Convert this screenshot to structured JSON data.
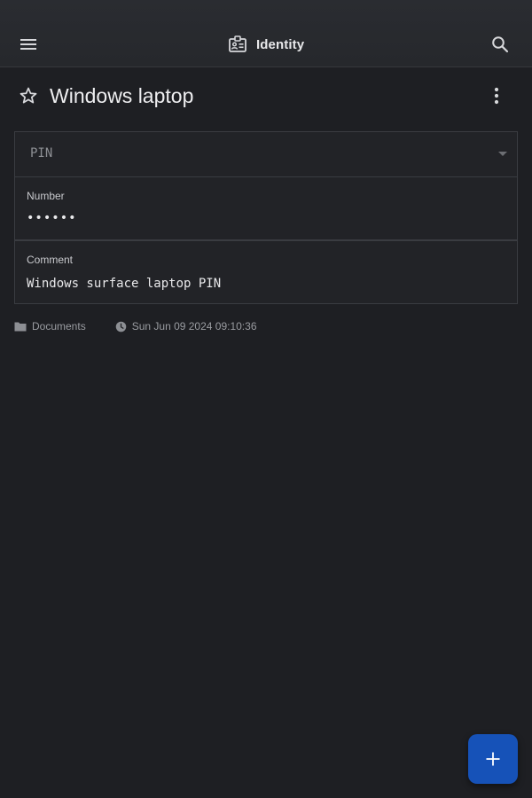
{
  "app_bar": {
    "title": "Identity",
    "menu_icon": "menu-icon",
    "title_icon": "identity-card-icon",
    "search_icon": "search-icon"
  },
  "entry": {
    "title": "Windows laptop",
    "favorite_icon": "star-outline-icon",
    "more_icon": "more-vertical-icon"
  },
  "fields": {
    "type": {
      "selected": "PIN"
    },
    "number": {
      "label": "Number",
      "value": "••••••"
    },
    "comment": {
      "label": "Comment",
      "value": "Windows surface laptop PIN"
    }
  },
  "meta": {
    "folder": "Documents",
    "modified": "Sun Jun 09 2024 09:10:36"
  },
  "fab": {
    "icon": "plus-icon"
  },
  "colors": {
    "background": "#1e1f23",
    "app_bar": "#27292d",
    "fab": "#1652b8",
    "field_border": "#3a3c41"
  }
}
